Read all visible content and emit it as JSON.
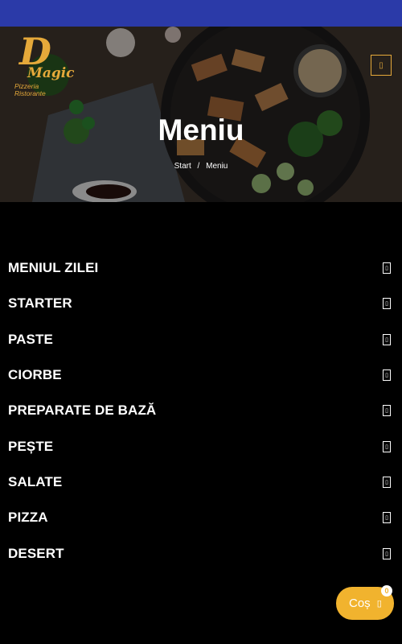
{
  "logo": {
    "letter": "D",
    "word": "Magic",
    "subtitle_1": "Pizzeria",
    "subtitle_2": "Ristorante"
  },
  "nav": {
    "menu_icon": "menu-icon"
  },
  "hero": {
    "title": "Meniu"
  },
  "breadcrumb": {
    "home": "Start",
    "separator": "/",
    "current": "Meniu"
  },
  "categories": [
    {
      "label": "MENIUL ZILEI"
    },
    {
      "label": "STARTER"
    },
    {
      "label": "PASTE"
    },
    {
      "label": "CIORBE"
    },
    {
      "label": "PREPARATE DE BAZĂ"
    },
    {
      "label": "PEȘTE"
    },
    {
      "label": "SALATE"
    },
    {
      "label": "PIZZA"
    },
    {
      "label": "DESERT"
    }
  ],
  "cart": {
    "label": "Coș",
    "count": "0",
    "icon": "cart-icon"
  },
  "colors": {
    "topbar": "#2b3aa8",
    "accent": "#e5a93a",
    "cart": "#f1b32e",
    "background": "#000000"
  }
}
